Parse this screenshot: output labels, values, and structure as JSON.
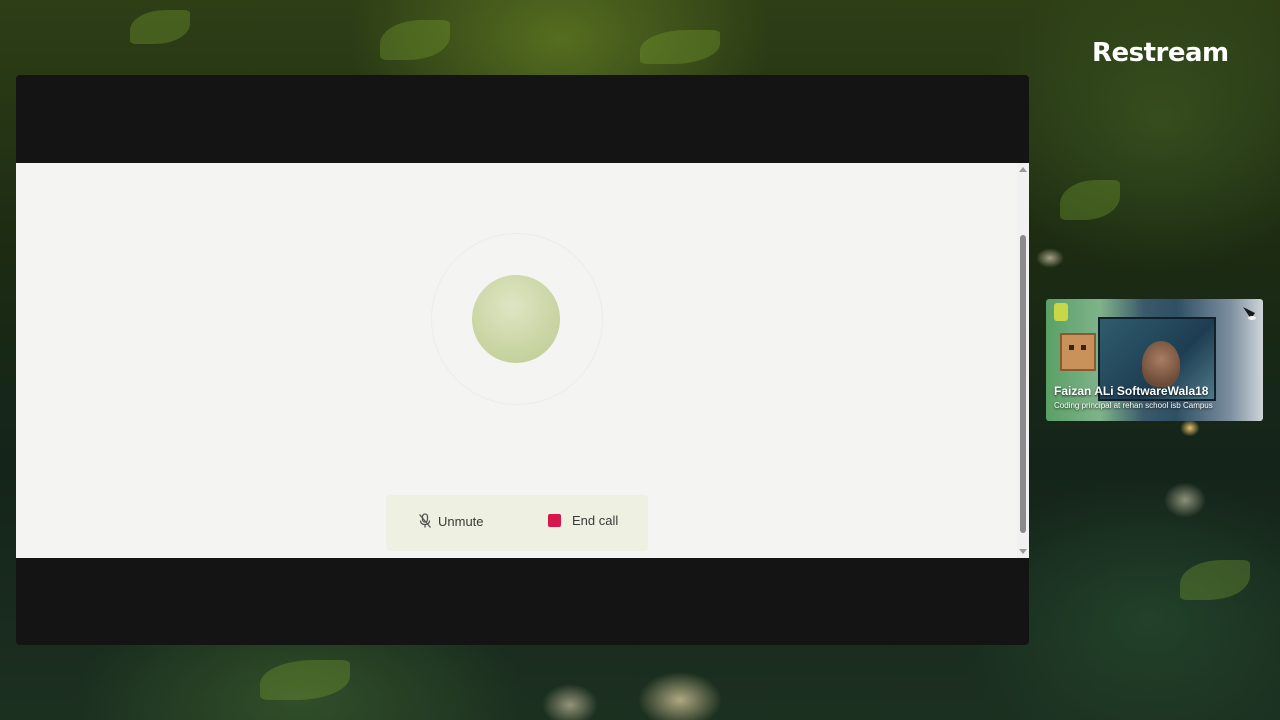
{
  "brand": {
    "name": "Restream"
  },
  "call": {
    "unmute_label": "Unmute",
    "end_call_label": "End call",
    "end_call_color": "#d6174e",
    "orb_color": "#cbd6a6"
  },
  "participant": {
    "name": "Faizan ALi SoftwareWala18",
    "subtitle": "Coding principal at rehan school isb Campus"
  },
  "icons": {
    "unmute": "muted-mic-icon",
    "end_call": "stop-square-icon"
  }
}
